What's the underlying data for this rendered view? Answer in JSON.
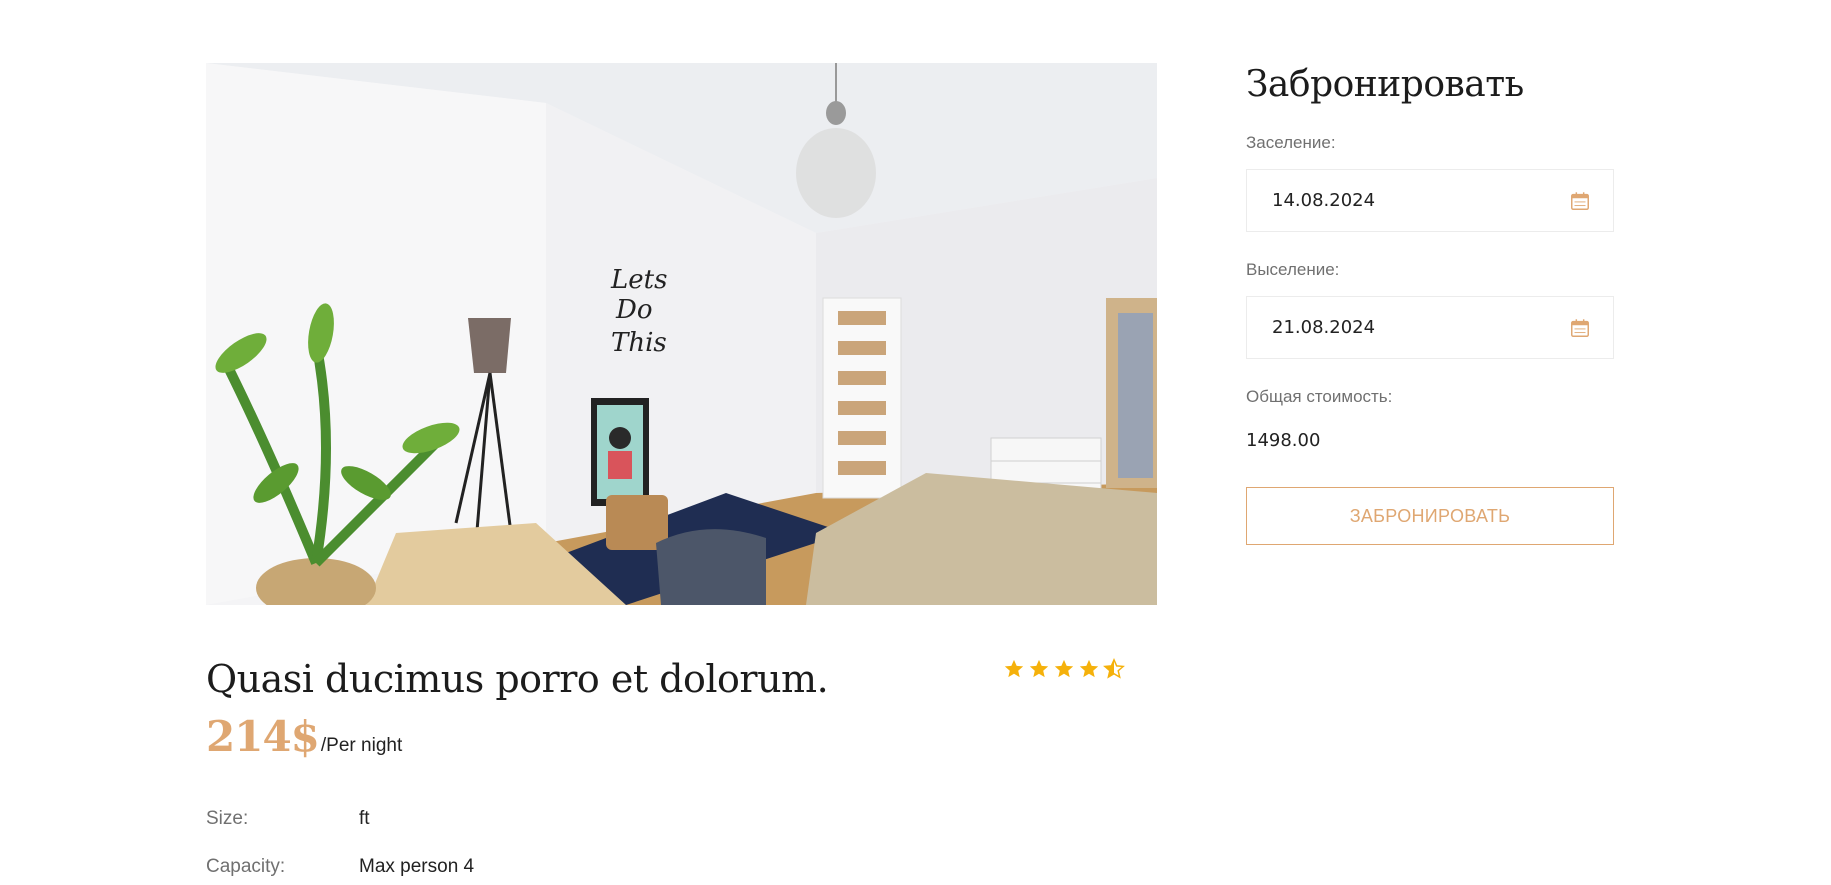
{
  "booking": {
    "title": "Забронировать",
    "checkin_label": "Заселение:",
    "checkin_value": "14.08.2024",
    "checkout_label": "Выселение:",
    "checkout_value": "21.08.2024",
    "total_label": "Общая стоимость:",
    "total_value": "1498.00",
    "button_label": "ЗАБРОНИРОВАТЬ"
  },
  "room": {
    "title": "Quasi ducimus porro et dolorum.",
    "price": "214$",
    "price_unit": "/Per night",
    "rating": 4.5,
    "rating_max": 5,
    "specs": [
      {
        "label": "Size:",
        "value": "ft"
      },
      {
        "label": "Capacity:",
        "value": "Max person 4"
      }
    ]
  },
  "colors": {
    "accent": "#dfa772",
    "star": "#f5b10b",
    "text": "#1c1c1c",
    "muted": "#707070"
  },
  "icons": {
    "calendar": "calendar-icon",
    "star": "star-icon"
  }
}
